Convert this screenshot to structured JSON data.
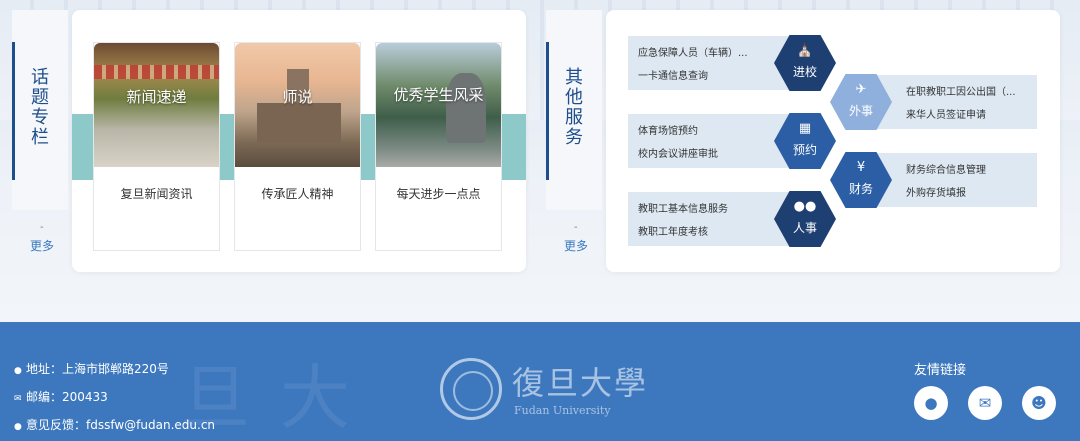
{
  "topics": {
    "title": "话题专栏",
    "more": "更多",
    "tiles": [
      {
        "caption": "新闻速递",
        "desc": "复旦新闻资讯"
      },
      {
        "caption": "师说",
        "desc": "传承匠人精神"
      },
      {
        "caption": "优秀学生风采",
        "desc": "每天进步一点点"
      }
    ]
  },
  "services": {
    "title": "其他服务",
    "more": "更多",
    "groups": [
      {
        "label": "进校",
        "icon": "building-icon",
        "items": [
          "应急保障人员（车辆）...",
          "一卡通信息查询"
        ]
      },
      {
        "label": "外事",
        "icon": "airplane-icon",
        "items": [
          "在职教职工因公出国（...",
          "来华人员签证申请"
        ]
      },
      {
        "label": "预约",
        "icon": "calendar-icon",
        "items": [
          "体育场馆预约",
          "校内会议讲座审批"
        ]
      },
      {
        "label": "财务",
        "icon": "yen-icon",
        "items": [
          "财务综合信息管理",
          "外购存货填报"
        ]
      },
      {
        "label": "人事",
        "icon": "people-icon",
        "items": [
          "教职工基本信息服务",
          "教职工年度考核"
        ]
      }
    ]
  },
  "footer": {
    "address": "地址：上海市邯郸路220号",
    "postcode": "邮编：200433",
    "feedback": "意见反馈：fdssfw@fudan.edu.cn",
    "brand_cn": "復旦大學",
    "brand_en": "Fudan University",
    "links_title": "友情链接",
    "links": [
      "wechat-icon",
      "mail-icon",
      "user-icon"
    ]
  }
}
